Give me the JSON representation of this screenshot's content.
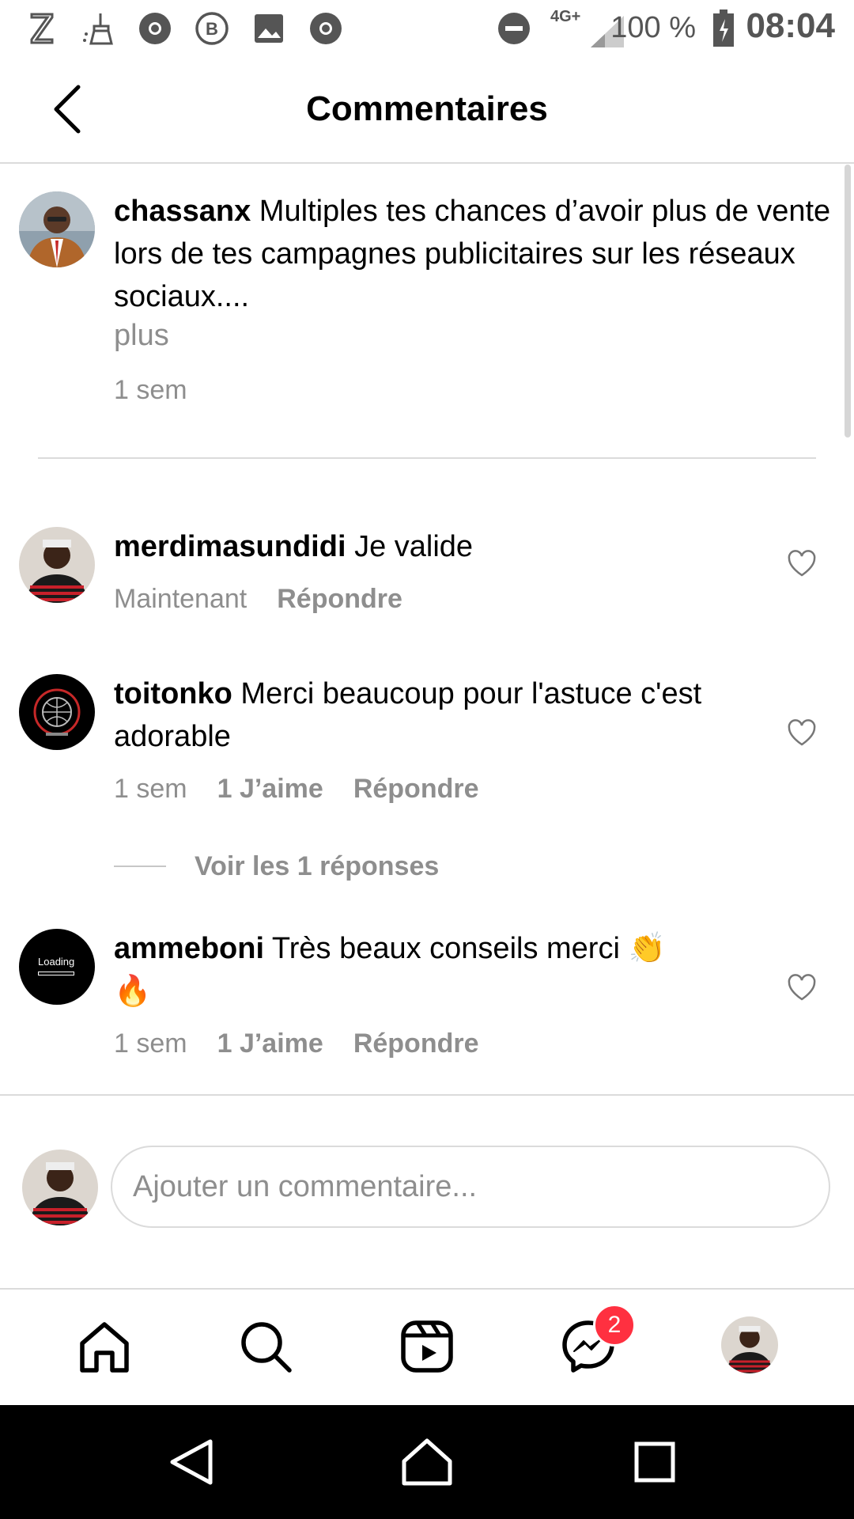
{
  "status_bar": {
    "network": "4G+",
    "battery": "100 %",
    "time": "08:04",
    "icons": [
      "s-logo-icon",
      "cleaner-icon",
      "chrome-icon",
      "whatsapp-business-icon",
      "gallery-icon",
      "chrome-icon",
      "do-not-disturb-icon",
      "signal-icon",
      "battery-icon"
    ]
  },
  "header": {
    "title": "Commentaires"
  },
  "caption": {
    "username": "chassanx",
    "text": "Multiples tes chances d’avoir plus de vente lors de tes campagnes publicitaires sur les réseaux sociaux....",
    "more_label": "plus",
    "time": "1 sem"
  },
  "comments": [
    {
      "username": "merdimasundidi",
      "text": "Je valide",
      "time": "Maintenant",
      "likes": "",
      "reply_label": "Répondre"
    },
    {
      "username": "toitonko",
      "text": "Merci beaucoup pour l'astuce c'est adorable",
      "time": "1 sem",
      "likes": "1 J’aime",
      "reply_label": "Répondre",
      "view_replies": "Voir les 1 réponses"
    },
    {
      "username": "ammeboni",
      "text": "Très beaux conseils merci 👏 🔥",
      "time": "1 sem",
      "likes": "1 J’aime",
      "reply_label": "Répondre"
    }
  ],
  "avatars": {
    "toitonko_logo_text": "Loading"
  },
  "composer": {
    "placeholder": "Ajouter un commentaire..."
  },
  "bottom_nav": {
    "items": [
      "home-icon",
      "search-icon",
      "reels-icon",
      "messenger-icon",
      "profile-avatar"
    ],
    "messenger_badge": "2"
  },
  "colors": {
    "secondary_text": "#8e8e8e",
    "divider": "#dbdbdb",
    "badge": "#ff3040"
  }
}
